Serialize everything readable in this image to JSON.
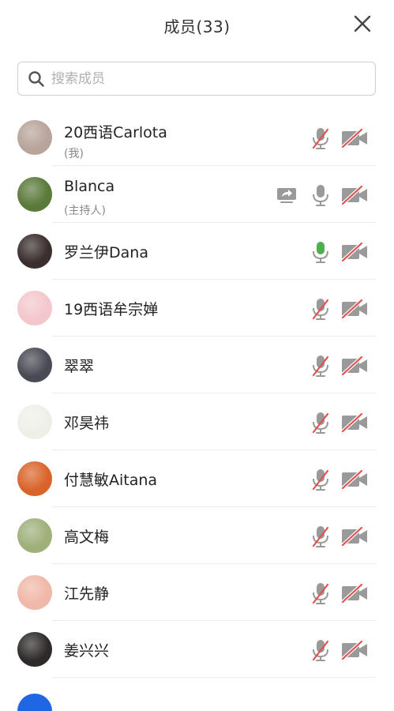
{
  "header": {
    "title": "成员(33)",
    "close_icon": "close-icon"
  },
  "search": {
    "placeholder": "搜索成员",
    "value": "",
    "icon": "search-icon"
  },
  "colors": {
    "mic_on": "#4caf50",
    "muted_slash": "#e0524f",
    "icon_gray": "#9a9a9a",
    "partial_avatar": "#1f66e5"
  },
  "members": [
    {
      "name": "20西语Carlota",
      "role": "(我)",
      "mic": "muted",
      "camera": "off",
      "avatar_color": "#b8a49a"
    },
    {
      "name": "Blanca",
      "role": "(主持人)",
      "mic": "on-gray",
      "camera": "off",
      "screen_share": true,
      "avatar_color": "#5a7a3a"
    },
    {
      "name": "罗兰伊Dana",
      "role": "",
      "mic": "on-green",
      "camera": "off",
      "avatar_color": "#3a2e2e"
    },
    {
      "name": "19西语牟宗婵",
      "role": "",
      "mic": "muted",
      "camera": "off",
      "avatar_color": "#f3c7cc"
    },
    {
      "name": "翠翠",
      "role": "",
      "mic": "muted",
      "camera": "off",
      "avatar_color": "#4a4a55"
    },
    {
      "name": "邓昊祎",
      "role": "",
      "mic": "muted",
      "camera": "off",
      "avatar_color": "#eef0e8"
    },
    {
      "name": "付慧敏Aitana",
      "role": "",
      "mic": "muted",
      "camera": "off",
      "avatar_color": "#d9642a"
    },
    {
      "name": "高文梅",
      "role": "",
      "mic": "muted",
      "camera": "off",
      "avatar_color": "#9fb07a"
    },
    {
      "name": "江先静",
      "role": "",
      "mic": "muted",
      "camera": "off",
      "avatar_color": "#f0b8a8"
    },
    {
      "name": "姜兴兴",
      "role": "",
      "mic": "muted",
      "camera": "off",
      "avatar_color": "#2e2a2a"
    }
  ]
}
